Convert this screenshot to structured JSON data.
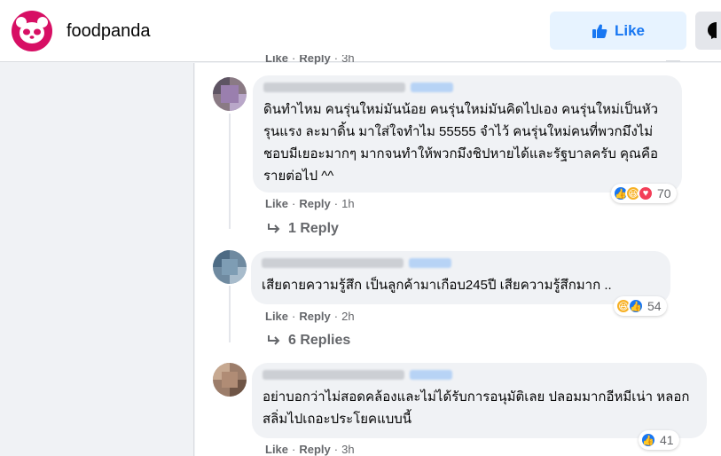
{
  "header": {
    "brand": "foodpanda",
    "like_label": "Like",
    "colors": {
      "brand": "#d70f64",
      "accent": "#1877f2"
    }
  },
  "top_actions": {
    "like": "Like",
    "sep": "·",
    "reply": "Reply",
    "time": "3h"
  },
  "comments": [
    {
      "text": "ดินทำไหม คนรุ่นใหม่มันน้อย คนรุ่นใหม่มันคิดไปเอง คนรุ่นใหม่เป็นหัวรุนแรง ละมาดิ้น มาใส่ใจทำไม 55555 จำไว้ คนรุ่นใหม่คนที่พวกมึงไม่ชอบมีเยอะมากๆ มากจนทำให้พวกมึงชิปหายได้และรัฐบาลครับ คุณคือรายต่อไป ^^",
      "reaction_icons": [
        "like",
        "haha",
        "love"
      ],
      "reaction_count": "70",
      "like": "Like",
      "sep": "·",
      "reply": "Reply",
      "time": "1h",
      "replies": "1 Reply"
    },
    {
      "text": "เสียดายความรู้สึก เป็นลูกค้ามาเกือบ245ปี เสียความรู้สึกมาก ..",
      "reaction_icons": [
        "haha",
        "like"
      ],
      "reaction_count": "54",
      "like": "Like",
      "sep": "·",
      "reply": "Reply",
      "time": "2h",
      "replies": "6 Replies"
    },
    {
      "text": "อย่าบอกว่าไม่สอดคล้องและไม่ได้รับการอนุมัติเลย ปลอมมากอีหมีเน่า หลอกสลิ่มไปเถอะประโยคแบบนี้",
      "reaction_icons": [
        "like"
      ],
      "reaction_count": "41",
      "like": "Like",
      "sep": "·",
      "reply": "Reply",
      "time": "3h"
    }
  ]
}
